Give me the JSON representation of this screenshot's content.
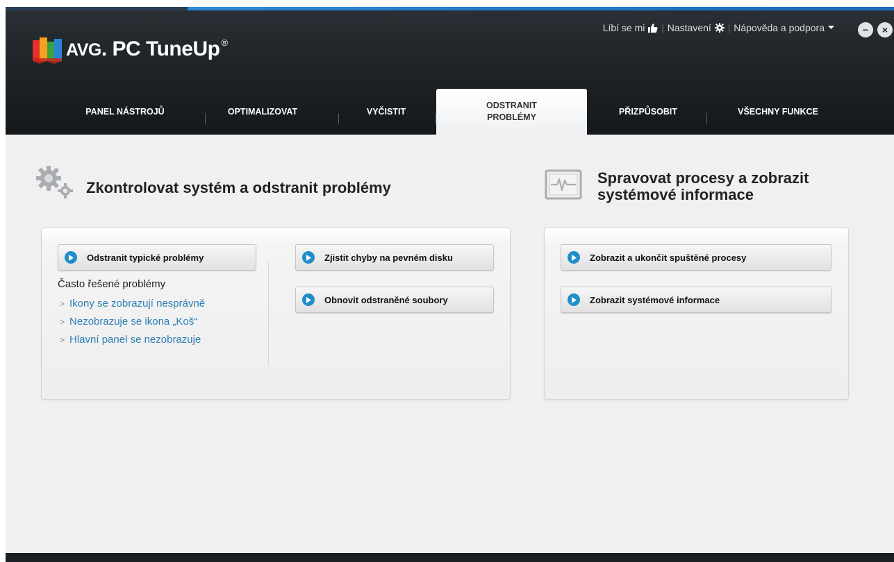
{
  "header": {
    "logo": {
      "brand": "AVG",
      "product": "PC TuneUp",
      "registered": "®"
    },
    "links": {
      "like": "Líbí se mi",
      "settings": "Nastavení",
      "help": "Nápověda a podpora"
    },
    "window": {
      "minimize": "−",
      "close": "×"
    }
  },
  "nav": {
    "tabs": [
      {
        "label": "PANEL NÁSTROJŮ"
      },
      {
        "label": "OPTIMALIZOVAT"
      },
      {
        "label": "VYČISTIT"
      },
      {
        "label_line1": "ODSTRANIT",
        "label_line2": "PROBLÉMY",
        "active": true
      },
      {
        "label": "PŘIZPŮSOBIT"
      },
      {
        "label": "VŠECHNY FUNKCE"
      }
    ]
  },
  "left_section": {
    "title": "Zkontrolovat systém a odstranit problémy",
    "icon": "gears-icon",
    "buttons": {
      "fix_common": "Odstranit typické problémy",
      "check_disk": "Zjistit chyby na pevném disku",
      "restore_files": "Obnovit odstraněné soubory"
    },
    "common_label": "Často řešené problémy",
    "problems": [
      "Ikony se zobrazují nesprávně",
      "Nezobrazuje se ikona „Koš“",
      "Hlavní panel se nezobrazuje"
    ]
  },
  "right_section": {
    "title_line1": "Spravovat procesy a zobrazit",
    "title_line2": "systémové informace",
    "icon": "monitor-pulse-icon",
    "buttons": {
      "processes": "Zobrazit a ukončit spuštěné procesy",
      "system_info": "Zobrazit systémové informace"
    }
  },
  "colors": {
    "header_dark": "#1f2428",
    "accent_blue": "#2c8ad8",
    "play_button": "#1f8ec9",
    "link_blue": "#2d7fb3",
    "content_bg": "#f0f0f0"
  }
}
